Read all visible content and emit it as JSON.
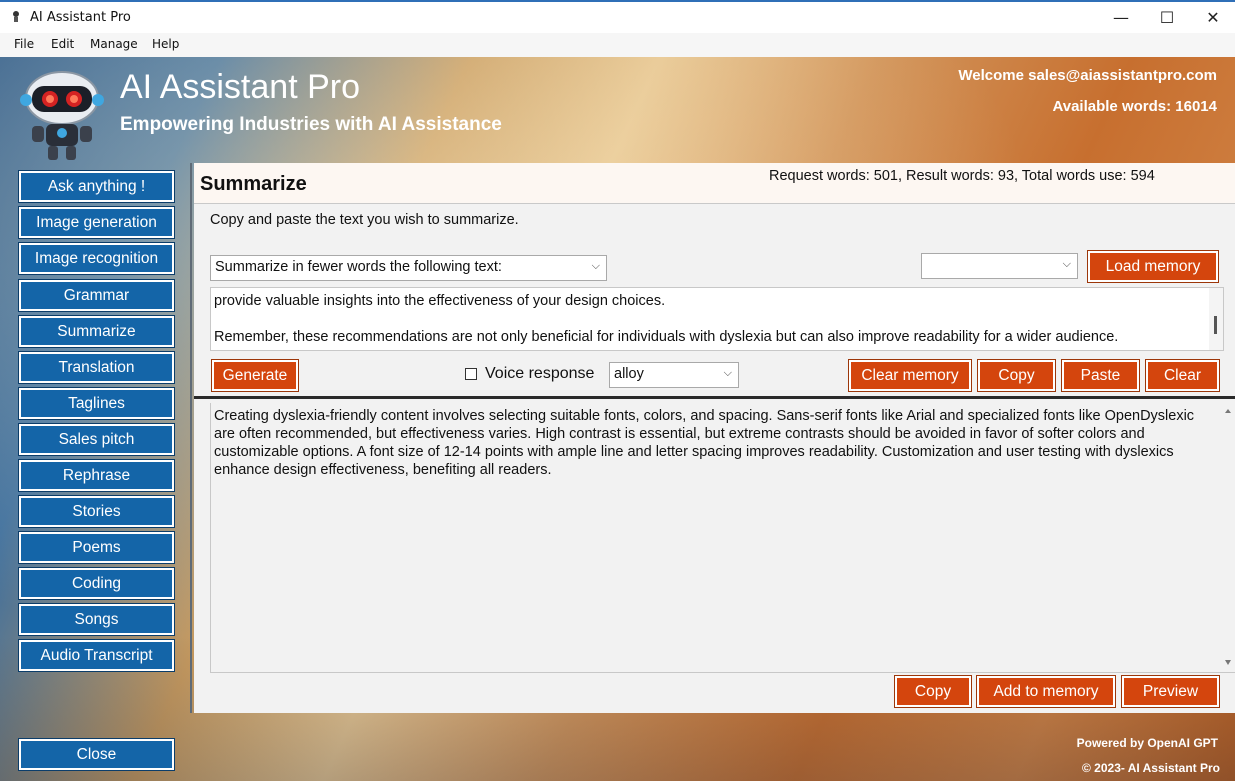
{
  "window": {
    "title": "AI Assistant Pro",
    "minimize_glyph": "—",
    "maximize_glyph": "☐",
    "close_glyph": "✕"
  },
  "menu": [
    "File",
    "Edit",
    "Manage",
    "Help"
  ],
  "header": {
    "app_title": "AI Assistant Pro",
    "tagline": "Empowering Industries with AI Assistance",
    "welcome": "Welcome sales@aiassistantpro.com",
    "available_words": "Available words: 16014"
  },
  "sidebar": {
    "items": [
      {
        "label": "Ask anything !"
      },
      {
        "label": "Image generation"
      },
      {
        "label": "Image recognition"
      },
      {
        "label": "Grammar"
      },
      {
        "label": "Summarize"
      },
      {
        "label": "Translation"
      },
      {
        "label": "Taglines"
      },
      {
        "label": "Sales pitch"
      },
      {
        "label": "Rephrase"
      },
      {
        "label": "Stories"
      },
      {
        "label": "Poems"
      },
      {
        "label": "Coding"
      },
      {
        "label": "Songs"
      },
      {
        "label": "Audio Transcript"
      }
    ],
    "close_label": "Close"
  },
  "panel": {
    "title": "Summarize",
    "stats": "Request words: 501, Result words: 93, Total words use: 594",
    "instruction": "Copy and paste the text you wish to summarize.",
    "prompt_select": "Summarize in fewer words the following text:",
    "memory_select": "",
    "load_memory": "Load memory",
    "input_line1": "provide valuable insights into the effectiveness of your design choices.",
    "input_line2": "Remember, these recommendations are not only beneficial for individuals with dyslexia but can also improve readability for a wider audience.",
    "generate": "Generate",
    "voice_label": "Voice response",
    "voice_checked": false,
    "voice_select": "alloy",
    "clear_memory": "Clear memory",
    "copy": "Copy",
    "paste": "Paste",
    "clear": "Clear",
    "output_text": "Creating dyslexia-friendly content involves selecting suitable fonts, colors, and spacing. Sans-serif fonts like Arial and specialized fonts like OpenDyslexic are often recommended, but effectiveness varies. High contrast is essential, but extreme contrasts should be avoided in favor of softer colors and customizable options. A font size of 12-14 points with ample line and letter spacing improves readability. Customization and user testing with dyslexics enhance design effectiveness, benefiting all readers.",
    "out_copy": "Copy",
    "add_to_memory": "Add to memory",
    "preview": "Preview"
  },
  "footer": {
    "powered": "Powered by OpenAI GPT",
    "copyright": "© 2023-  AI Assistant Pro"
  }
}
